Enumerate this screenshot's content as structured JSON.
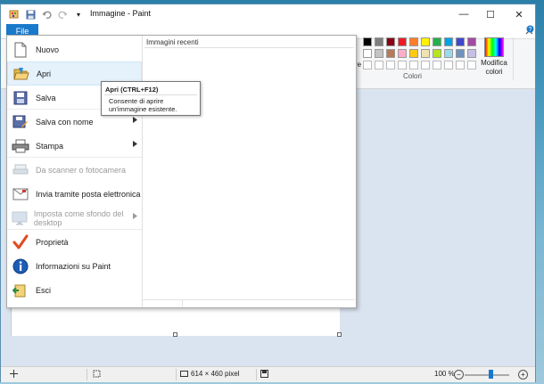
{
  "window": {
    "title": "Immagine - Paint",
    "quick_access_dropdown": "▾",
    "controls": {
      "minimize": "—",
      "maximize": "☐",
      "close": "✕"
    }
  },
  "ribbon": {
    "file_tab": "File",
    "colors_group_label": "Colori",
    "edit_colors_label": "Modifica colori",
    "partial_label": "re",
    "collapse_icon": "chevron-up-icon",
    "help_icon": "help-icon",
    "palette_row1": [
      "#000000",
      "#7f7f7f",
      "#880015",
      "#ed1c24",
      "#ff7f27",
      "#fff200",
      "#22b14c",
      "#00a2e8",
      "#3f48cc",
      "#a349a4"
    ],
    "palette_row2": [
      "#ffffff",
      "#c3c3c3",
      "#b97a57",
      "#ffaec9",
      "#ffc90e",
      "#efe4b0",
      "#b5e61d",
      "#99d9ea",
      "#7092be",
      "#c8bfe7"
    ]
  },
  "file_menu": {
    "items": [
      {
        "label": "Nuovo",
        "icon": "new-document-icon",
        "enabled": true,
        "submenu": false
      },
      {
        "label": "Apri",
        "icon": "open-folder-icon",
        "enabled": true,
        "submenu": false
      },
      {
        "label": "Salva",
        "icon": "save-icon",
        "enabled": true,
        "submenu": false
      },
      {
        "label": "Salva con nome",
        "icon": "save-as-icon",
        "enabled": true,
        "submenu": true
      },
      {
        "label": "Stampa",
        "icon": "print-icon",
        "enabled": true,
        "submenu": true
      },
      {
        "label": "Da scanner o fotocamera",
        "icon": "scanner-icon",
        "enabled": false,
        "submenu": false
      },
      {
        "label": "Invia tramite posta elettronica",
        "icon": "email-icon",
        "enabled": true,
        "submenu": false
      },
      {
        "label": "Imposta come sfondo del desktop",
        "icon": "desktop-background-icon",
        "enabled": false,
        "submenu": true
      },
      {
        "label": "Proprietà",
        "icon": "properties-checkmark-icon",
        "enabled": true,
        "submenu": false
      },
      {
        "label": "Informazioni su Paint",
        "icon": "info-icon",
        "enabled": true,
        "submenu": false
      },
      {
        "label": "Esci",
        "icon": "exit-icon",
        "enabled": true,
        "submenu": false
      }
    ],
    "recent_title": "Immagini recenti"
  },
  "tooltip": {
    "title": "Apri (CTRL+F12)",
    "body": "Consente di aprire un'immagine esistente."
  },
  "status_bar": {
    "image_size": "614 × 460 pixel",
    "zoom": "100 %",
    "zoom_minus": "−",
    "zoom_plus": "+"
  }
}
